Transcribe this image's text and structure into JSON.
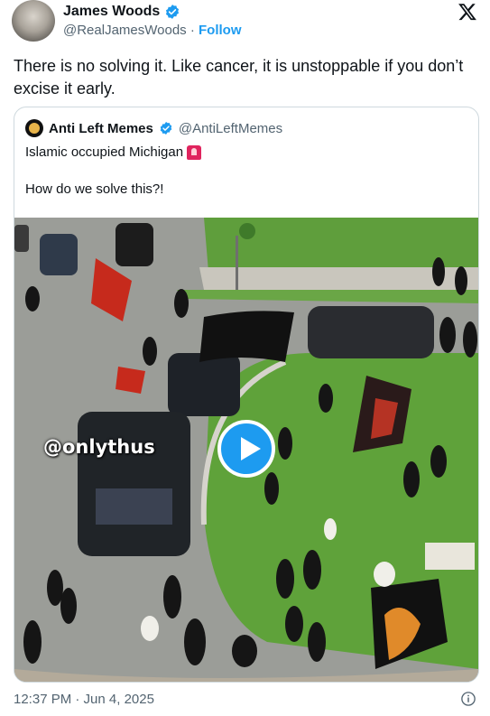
{
  "author": {
    "name": "James Woods",
    "handle": "@RealJamesWoods",
    "separator": " · ",
    "follow_label": "Follow"
  },
  "tweet": {
    "text": "There is no solving it. Like cancer, it is unstoppable if you don’t excise it early.",
    "timestamp": "12:37 PM · Jun 4, 2025"
  },
  "quote": {
    "author_name": "Anti Left Memes",
    "author_handle": "@AntiLeftMemes",
    "line1": "Islamic occupied Michigan",
    "line2": "How do we solve this?!",
    "media": {
      "watermark": "@onlythus",
      "type": "video"
    }
  },
  "icons": {
    "verified": "verified-badge-icon",
    "x_logo": "x-logo-icon",
    "play": "play-icon",
    "info": "info-icon",
    "siren": "rotating-light-icon"
  },
  "colors": {
    "accent": "#1d9bf0",
    "text": "#0f1419",
    "muted": "#536471",
    "border": "#cfd9de"
  }
}
